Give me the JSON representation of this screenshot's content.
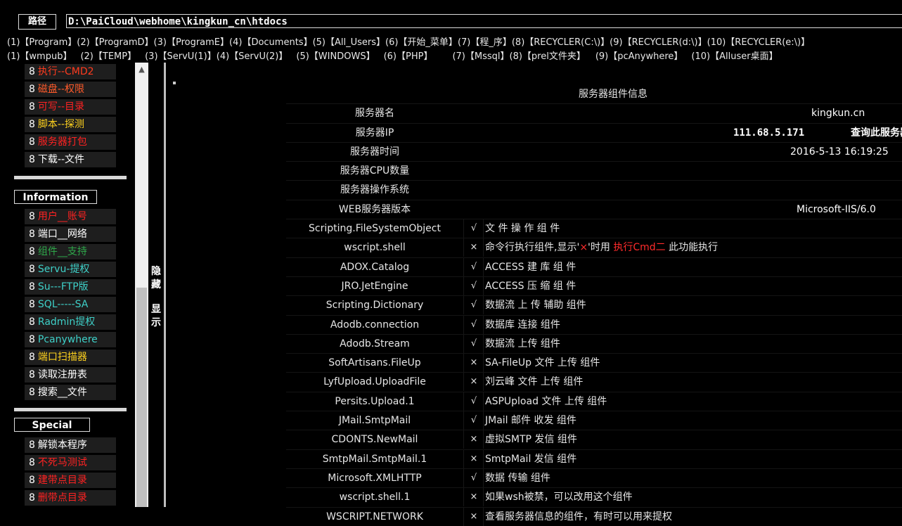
{
  "path": {
    "label": "路径",
    "value": "D:\\PaiCloud\\webhome\\kingkun_cn\\htdocs"
  },
  "quick_row1": [
    "(1)【Program】",
    "(2)【ProgramD】",
    "(3)【ProgramE】",
    "(4)【Documents】",
    "(5)【All_Users】",
    "(6)【开始_菜单】",
    "(7)【程_序】",
    "(8)【RECYCLER(C:\\)】",
    "(9)【RECYCLER(d:\\)】",
    "(10)【RECYCLER(e:\\)】"
  ],
  "quick_row2": [
    "(1)【wmpub】",
    "(2)【TEMP】",
    "(3)【ServU(1)】",
    "(4)【ServU(2)】",
    "(5)【WINDOWS】",
    "(6)【PHP】",
    "(7)【Mssql】",
    "(8)【prel文件夹】",
    "(9)【pcAnywhere】",
    "(10)【Alluser桌面】"
  ],
  "sidebar": {
    "group1": [
      {
        "num": "8",
        "label": "执行--CMD2",
        "color": "#ff3b1e"
      },
      {
        "num": "8",
        "label": "磁盘--权限",
        "color": "#ff5a2a"
      },
      {
        "num": "8",
        "label": "可写--目录",
        "color": "#ff2222"
      },
      {
        "num": "8",
        "label": "脚本--探测",
        "color": "#ffd21e"
      },
      {
        "num": "8",
        "label": "服务器打包",
        "color": "#ff2222"
      },
      {
        "num": "8",
        "label": "下载--文件",
        "color": "#ffffff"
      }
    ],
    "info_head": "Information",
    "group2": [
      {
        "num": "8",
        "label": "用户__账号",
        "color": "#ff2222"
      },
      {
        "num": "8",
        "label": "端口__网络",
        "color": "#ffffff"
      },
      {
        "num": "8",
        "label": "组件__支持",
        "color": "#2ea84a"
      },
      {
        "num": "8",
        "label": "Servu-提权",
        "color": "#3ed0c8"
      },
      {
        "num": "8",
        "label": "Su---FTP版",
        "color": "#3ed0c8"
      },
      {
        "num": "8",
        "label": "SQL-----SA",
        "color": "#3ed0c8"
      },
      {
        "num": "8",
        "label": "Radmin提权",
        "color": "#3ed0c8"
      },
      {
        "num": "8",
        "label": "Pcanywhere",
        "color": "#3ed0c8"
      },
      {
        "num": "8",
        "label": "端口扫描器",
        "color": "#ffd21e"
      },
      {
        "num": "8",
        "label": "读取注册表",
        "color": "#ffffff"
      },
      {
        "num": "8",
        "label": "搜索__文件",
        "color": "#ffffff"
      }
    ],
    "special_head": "Special",
    "group3": [
      {
        "num": "8",
        "label": "解锁本程序",
        "color": "#ffffff"
      },
      {
        "num": "8",
        "label": "不死马测试",
        "color": "#ff2222"
      },
      {
        "num": "8",
        "label": "建带点目录",
        "color": "#ff2222"
      },
      {
        "num": "8",
        "label": "删带点目录",
        "color": "#ff2222"
      }
    ]
  },
  "hide_show": {
    "hide": [
      "隐",
      "藏"
    ],
    "show": [
      "显",
      "示"
    ]
  },
  "info_table": {
    "title": "服务器组件信息",
    "server_name_label": "服务器名",
    "server_name": "kingkun.cn",
    "server_ip_label": "服务器IP",
    "server_ip": "111.68.5.171",
    "query_label": "查询此服务器",
    "server_time_label": "服务器时间",
    "server_time": "2016-5-13 16:19:25",
    "cpu_label": "服务器CPU数量",
    "os_label": "服务器操作系统",
    "web_label": "WEB服务器版本",
    "web_value": "Microsoft-IIS/6.0",
    "components": [
      {
        "name": "Scripting.FileSystemObject",
        "ok": "√",
        "desc": "文 件 操 作 组 件"
      },
      {
        "name": "wscript.shell",
        "ok": "×",
        "desc_pre": "命令行执行组件,显示'",
        "desc_x": "×",
        "desc_mid": "'时用 ",
        "desc_red": "执行Cmd二",
        "desc_post": " 此功能执行"
      },
      {
        "name": "ADOX.Catalog",
        "ok": "√",
        "desc": "ACCESS 建 库 组 件"
      },
      {
        "name": "JRO.JetEngine",
        "ok": "√",
        "desc": "ACCESS 压 缩 组 件"
      },
      {
        "name": "Scripting.Dictionary",
        "ok": "√",
        "desc": "数据流 上 传 辅助 组件"
      },
      {
        "name": "Adodb.connection",
        "ok": "√",
        "desc": "数据库 连接 组件"
      },
      {
        "name": "Adodb.Stream",
        "ok": "√",
        "desc": "数据流 上传 组件"
      },
      {
        "name": "SoftArtisans.FileUp",
        "ok": "×",
        "desc": "SA-FileUp 文件 上传 组件"
      },
      {
        "name": "LyfUpload.UploadFile",
        "ok": "×",
        "desc": "刘云峰 文件 上传 组件"
      },
      {
        "name": "Persits.Upload.1",
        "ok": "√",
        "desc": "ASPUpload 文件 上传 组件"
      },
      {
        "name": "JMail.SmtpMail",
        "ok": "√",
        "desc": "JMail 邮件 收发 组件"
      },
      {
        "name": "CDONTS.NewMail",
        "ok": "×",
        "desc": "虚拟SMTP 发信 组件"
      },
      {
        "name": "SmtpMail.SmtpMail.1",
        "ok": "×",
        "desc": "SmtpMail 发信 组件"
      },
      {
        "name": "Microsoft.XMLHTTP",
        "ok": "√",
        "desc": "数据 传输 组件"
      },
      {
        "name": "wscript.shell.1",
        "ok": "×",
        "desc": "如果wsh被禁，可以改用这个组件"
      },
      {
        "name": "WSCRIPT.NETWORK",
        "ok": "×",
        "desc": "查看服务器信息的组件，有时可以用来提权"
      }
    ]
  },
  "colors": {
    "background": "#000000",
    "menu_bg": "#1e1e1e",
    "red": "#ff2b2b"
  },
  "scrollbar": {
    "up_arrow": "chevron-up-icon"
  }
}
